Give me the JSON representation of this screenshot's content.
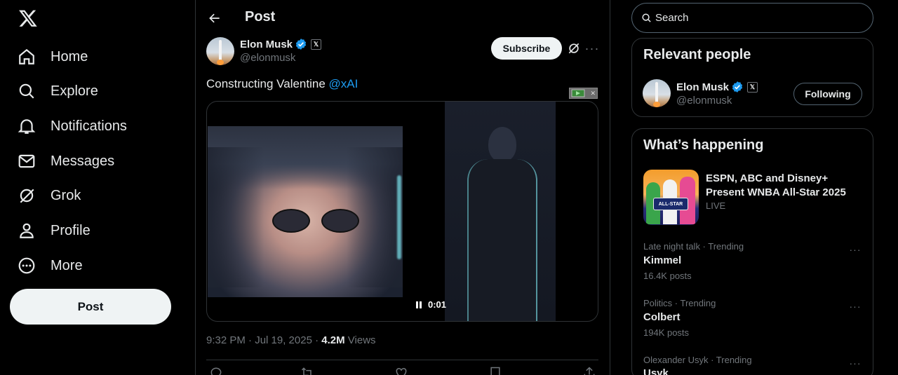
{
  "sidebar": {
    "logo": "x-logo-icon",
    "items": [
      {
        "label": "Home",
        "icon": "home-icon"
      },
      {
        "label": "Explore",
        "icon": "search-icon"
      },
      {
        "label": "Notifications",
        "icon": "bell-icon"
      },
      {
        "label": "Messages",
        "icon": "envelope-icon"
      },
      {
        "label": "Grok",
        "icon": "grok-icon"
      },
      {
        "label": "Profile",
        "icon": "person-icon"
      },
      {
        "label": "More",
        "icon": "more-circle-icon"
      }
    ],
    "post_label": "Post"
  },
  "header": {
    "title": "Post"
  },
  "tweet": {
    "author_name": "Elon Musk",
    "handle": "@elonmusk",
    "subscribe_label": "Subscribe",
    "text": "Constructing Valentine",
    "mention": "@xAI",
    "video_time": "0:01",
    "timestamp": "9:32 PM · Jul 19, 2025 · ",
    "views_count": "4.2M",
    "views_label": " Views"
  },
  "search": {
    "placeholder": "Search"
  },
  "relevant": {
    "title": "Relevant people",
    "name": "Elon Musk",
    "handle": "@elonmusk",
    "button_label": "Following"
  },
  "happening": {
    "title": "What’s happening",
    "event": {
      "title": "ESPN, ABC and Disney+ Present WNBA All-Star 2025",
      "status": "LIVE",
      "badge": "ALL-STAR"
    },
    "trends": [
      {
        "meta": "Late night talk · Trending",
        "name": "Kimmel",
        "count": "16.4K posts"
      },
      {
        "meta": "Politics · Trending",
        "name": "Colbert",
        "count": "194K posts"
      },
      {
        "meta": "Olexander Usyk · Trending",
        "name": "Usyk",
        "count": ""
      }
    ]
  },
  "colors": {
    "accent": "#1d9bf0",
    "background": "#000000",
    "border": "#2f3336",
    "muted": "#71767b"
  }
}
